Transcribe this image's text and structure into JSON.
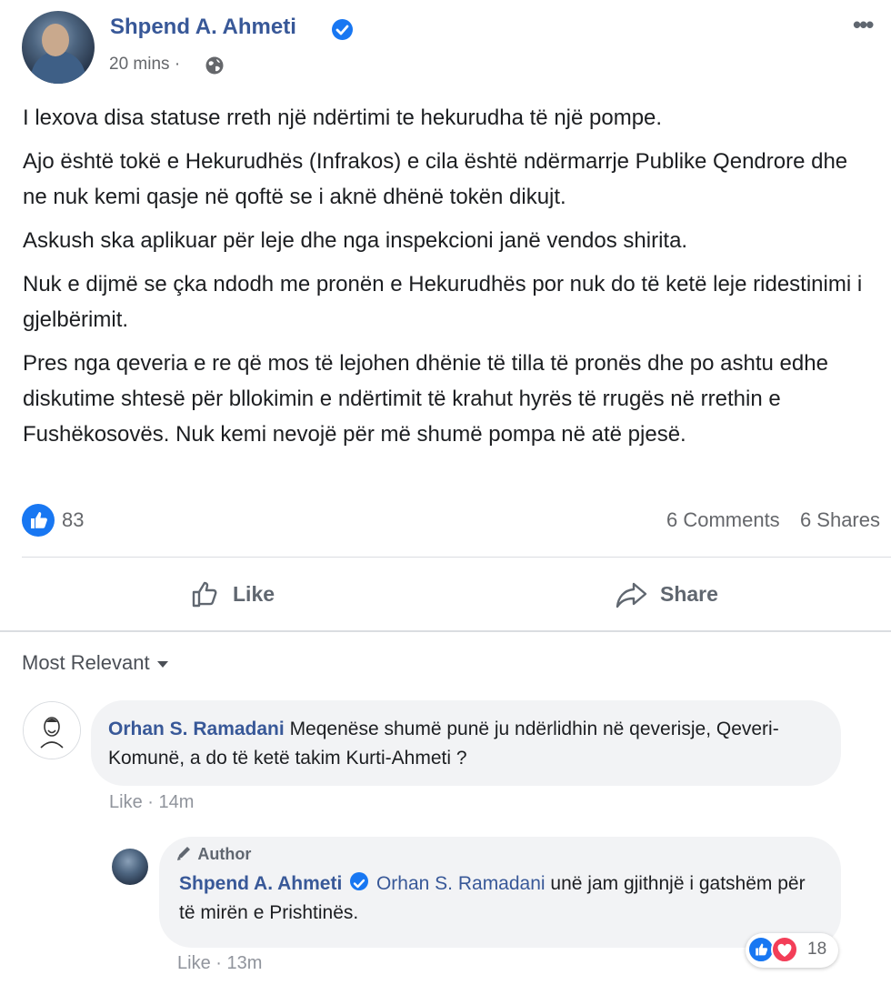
{
  "post": {
    "author": "Shpend A. Ahmeti",
    "time": "20 mins",
    "paragraphs": [
      "I lexova disa statuse rreth një ndërtimi te hekurudha të një pompe.",
      "Ajo është tokë e Hekurudhës (Infrakos) e cila është ndërmarrje Publike Qendrore dhe ne nuk kemi qasje në qoftë se i aknë dhënë tokën dikujt.",
      "Askush ska aplikuar për leje dhe nga inspekcioni janë vendos shirita.",
      "Nuk e dijmë se çka ndodh me pronën e Hekurudhës por nuk do të ketë leje ridestinimi i gjelbërimit.",
      "Pres nga qeveria e re që mos të lejohen dhënie të tilla të pronës dhe po ashtu edhe diskutime shtesë për bllokimin e ndërtimit të krahut hyrës të rrugës në rrethin e Fushëkosovës. Nuk kemi nevojë për më shumë pompa në atë pjesë."
    ],
    "reaction_count": "83",
    "comments_label": "6 Comments",
    "shares_label": "6 Shares",
    "like_label": "Like",
    "share_label": "Share"
  },
  "sort_label": "Most Relevant",
  "comments": [
    {
      "author": "Orhan S. Ramadani",
      "text": "Meqenëse shumë punë ju ndërlidhin në qeverisje, Qeveri-Komunë, a do të ketë takim Kurti-Ahmeti ?",
      "like_label": "Like",
      "time": "14m"
    }
  ],
  "reply": {
    "badge": "Author",
    "author": "Shpend A. Ahmeti",
    "mention": "Orhan S. Ramadani",
    "text": "unë jam gjithnjë i gatshëm për të mirën e Prishtinës.",
    "like_label": "Like",
    "time": "13m",
    "reaction_count": "18"
  },
  "colors": {
    "link": "#385898",
    "accent": "#1877f2",
    "love": "#f33e58",
    "muted": "#65676b"
  },
  "icons": [
    "verified-icon",
    "globe-icon",
    "more-icon",
    "like-reaction-icon",
    "thumbs-up-icon",
    "share-arrow-icon",
    "caret-down-icon",
    "pen-icon",
    "love-reaction-icon"
  ]
}
